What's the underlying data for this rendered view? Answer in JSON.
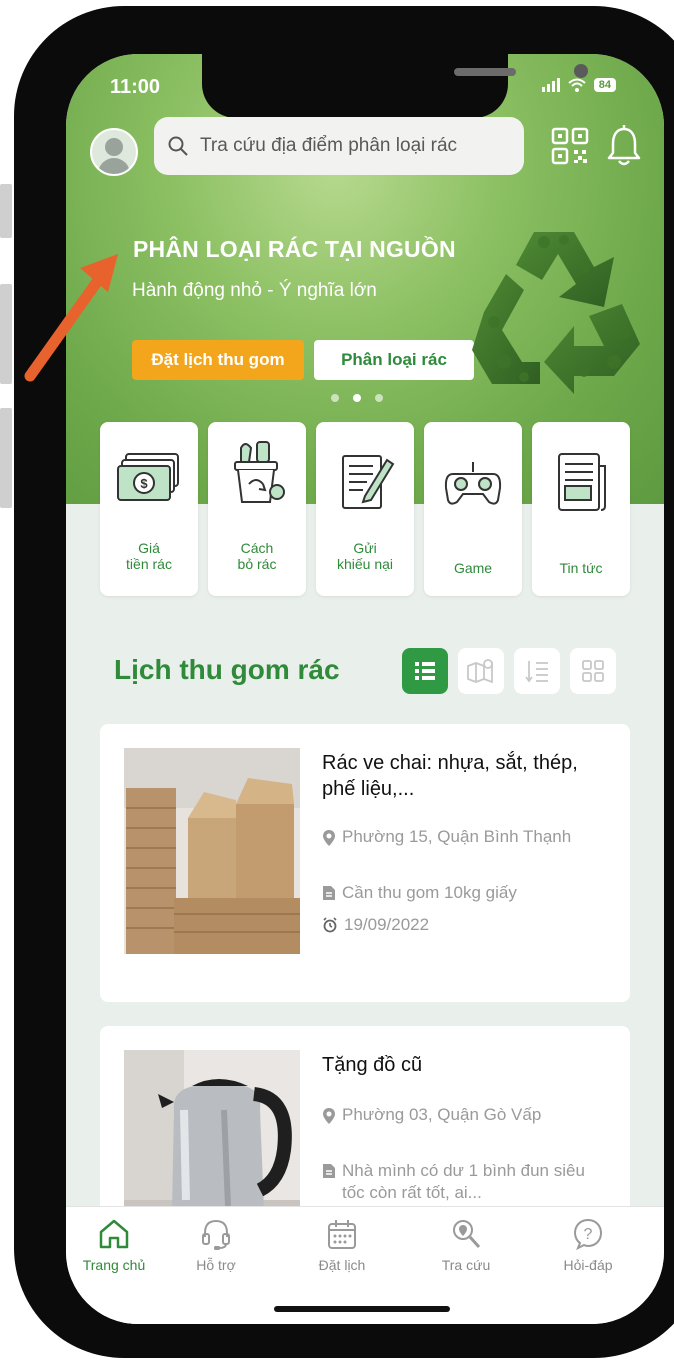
{
  "status_bar": {
    "time": "11:00",
    "battery": "84"
  },
  "search": {
    "placeholder": "Tra cứu địa điểm phân loại rác"
  },
  "banner": {
    "title": "PHÂN LOẠI RÁC TẠI NGUỒN",
    "subtitle": "Hành động nhỏ - Ý nghĩa lớn",
    "primary_button": "Đặt lịch thu gom",
    "secondary_button": "Phân loại rác",
    "carousel_pages": 3,
    "active_page": 2
  },
  "categories": [
    {
      "label": "Giá\ntiền rác",
      "icon": "money-icon"
    },
    {
      "label": "Cách\nbỏ rác",
      "icon": "recycle-bin-icon"
    },
    {
      "label": "Gửi\nkhiếu nại",
      "icon": "complaint-icon"
    },
    {
      "label": "Game",
      "icon": "gamepad-icon"
    },
    {
      "label": "Tin tức",
      "icon": "news-icon"
    }
  ],
  "schedule": {
    "title": "Lịch thu gom rác",
    "view_modes": [
      "list-view-icon",
      "map-view-icon",
      "sort-view-icon",
      "grid-view-icon"
    ],
    "active_view": "list-view-icon",
    "items": [
      {
        "title": "Rác ve chai: nhựa, sắt, thép, phế liệu,...",
        "location": "Phường 15, Quận Bình Thạnh",
        "note": "Cần thu gom 10kg giấy",
        "date": "19/09/2022",
        "image": "cardboard-boxes"
      },
      {
        "title": "Tặng đồ cũ",
        "location": "Phường 03, Quận Gò Vấp",
        "note": "Nhà mình có dư 1 bình đun siêu tốc còn rất tốt, ai...",
        "image": "electric-kettle"
      }
    ]
  },
  "bottom_nav": [
    {
      "label": "Trang chủ",
      "icon": "home-icon",
      "active": true
    },
    {
      "label": "Hỗ trợ",
      "icon": "headset-icon",
      "active": false
    },
    {
      "label": "Đặt lịch",
      "icon": "calendar-icon",
      "active": false
    },
    {
      "label": "Tra cứu",
      "icon": "search-location-icon",
      "active": false
    },
    {
      "label": "Hỏi-đáp",
      "icon": "question-icon",
      "active": false
    }
  ],
  "colors": {
    "brand_green": "#2f8a3a",
    "accent_orange": "#f3a51c",
    "annotation_arrow": "#e8622d"
  }
}
